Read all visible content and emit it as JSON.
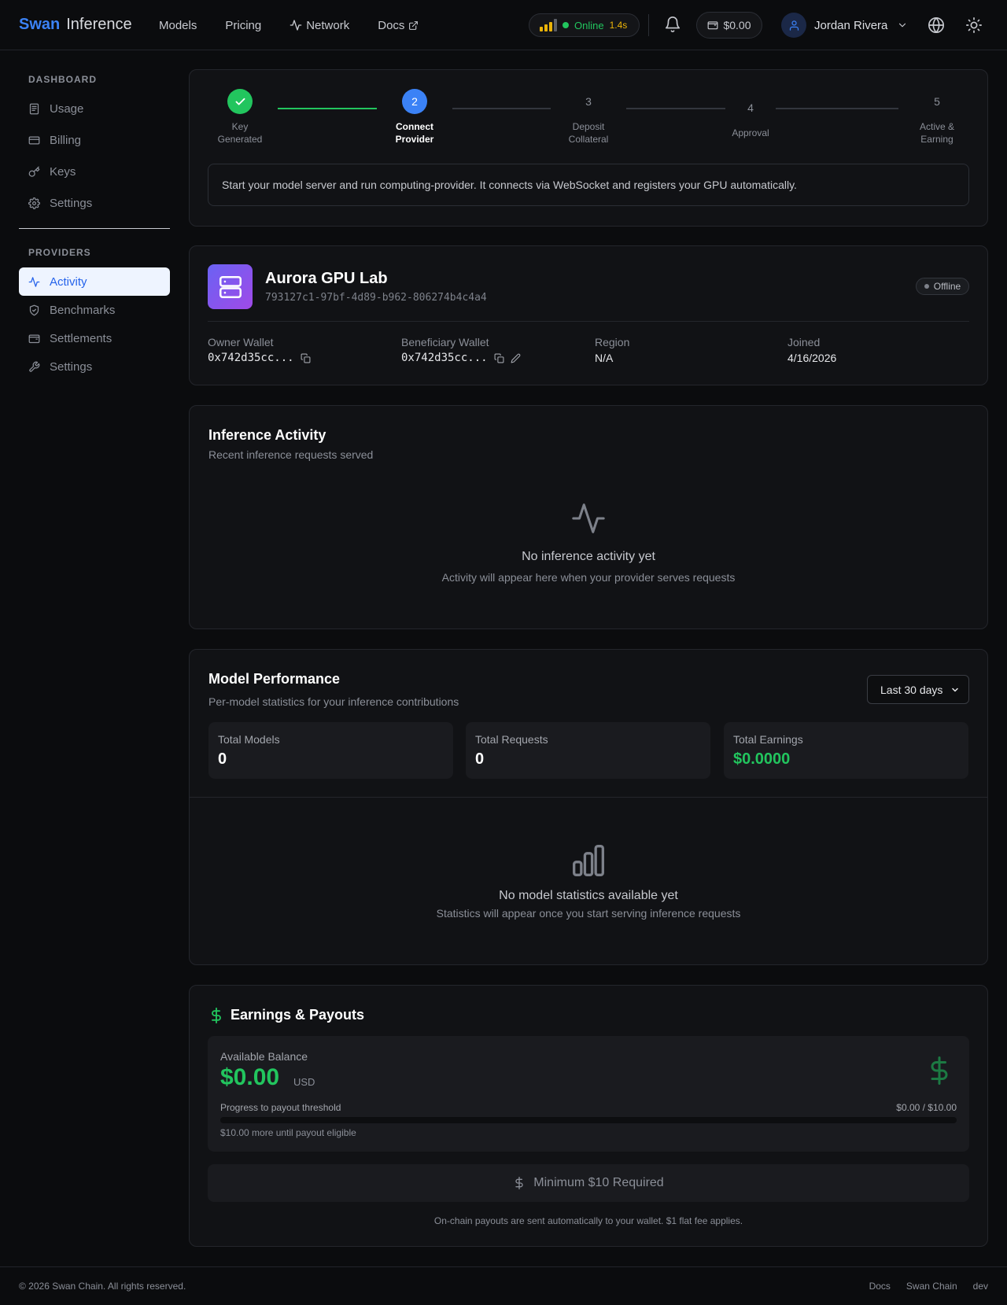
{
  "brand": {
    "primary": "Swan",
    "secondary": "Inference"
  },
  "nav": {
    "models": "Models",
    "pricing": "Pricing",
    "network": "Network",
    "docs": "Docs"
  },
  "status": {
    "label": "Online",
    "latency": "1.4s"
  },
  "wallet": {
    "balance": "$0.00"
  },
  "user": {
    "name": "Jordan Rivera"
  },
  "sidebar": {
    "dashboard_title": "DASHBOARD",
    "dashboard_items": [
      {
        "label": "Usage",
        "icon": "receipt-icon"
      },
      {
        "label": "Billing",
        "icon": "credit-card-icon"
      },
      {
        "label": "Keys",
        "icon": "key-icon"
      },
      {
        "label": "Settings",
        "icon": "gear-icon"
      }
    ],
    "providers_title": "PROVIDERS",
    "provider_items": [
      {
        "label": "Activity",
        "icon": "activity-icon",
        "active": true
      },
      {
        "label": "Benchmarks",
        "icon": "shield-icon"
      },
      {
        "label": "Settlements",
        "icon": "wallet-icon"
      },
      {
        "label": "Settings",
        "icon": "wrench-icon"
      }
    ]
  },
  "stepper": {
    "steps": [
      {
        "num": "",
        "label_line1": "Key",
        "label_line2": "Generated",
        "state": "done"
      },
      {
        "num": "2",
        "label_line1": "Connect",
        "label_line2": "Provider",
        "state": "current"
      },
      {
        "num": "3",
        "label_line1": "Deposit",
        "label_line2": "Collateral",
        "state": "pending"
      },
      {
        "num": "4",
        "label_line1": "Approval",
        "label_line2": "",
        "state": "pending"
      },
      {
        "num": "5",
        "label_line1": "Active &",
        "label_line2": "Earning",
        "state": "pending"
      }
    ],
    "info": "Start your model server and run computing-provider. It connects via WebSocket and registers your GPU automatically."
  },
  "provider": {
    "name": "Aurora GPU Lab",
    "id": "793127c1-97bf-4d89-b962-806274b4c4a4",
    "status": "Offline",
    "owner_wallet_label": "Owner Wallet",
    "owner_wallet": "0x742d35cc...",
    "beneficiary_wallet_label": "Beneficiary Wallet",
    "beneficiary_wallet": "0x742d35cc...",
    "region_label": "Region",
    "region": "N/A",
    "joined_label": "Joined",
    "joined": "4/16/2026"
  },
  "activity": {
    "title": "Inference Activity",
    "subtitle": "Recent inference requests served",
    "empty_title": "No inference activity yet",
    "empty_sub": "Activity will appear here when your provider serves requests"
  },
  "performance": {
    "title": "Model Performance",
    "subtitle": "Per-model statistics for your inference contributions",
    "range": "Last 30 days",
    "stats": [
      {
        "label": "Total Models",
        "value": "0"
      },
      {
        "label": "Total Requests",
        "value": "0"
      },
      {
        "label": "Total Earnings",
        "value": "$0.0000"
      }
    ],
    "empty_title": "No model statistics available yet",
    "empty_sub": "Statistics will appear once you start serving inference requests"
  },
  "earnings": {
    "title": "Earnings & Payouts",
    "balance_label": "Available Balance",
    "balance": "$0.00",
    "currency": "USD",
    "progress_label": "Progress to payout threshold",
    "progress_value": "$0.00 / $10.00",
    "progress_fraction": 0,
    "progress_note": "$10.00 more until payout eligible",
    "button": "Minimum $10 Required",
    "note": "On-chain payouts are sent automatically to your wallet. $1 flat fee applies."
  },
  "footer": {
    "copyright": "© 2026 Swan Chain. All rights reserved.",
    "links": [
      "Docs",
      "Swan Chain",
      "dev"
    ]
  },
  "colors": {
    "accent": "#3b82f6",
    "success": "#22c55e",
    "warning": "#eab308"
  }
}
